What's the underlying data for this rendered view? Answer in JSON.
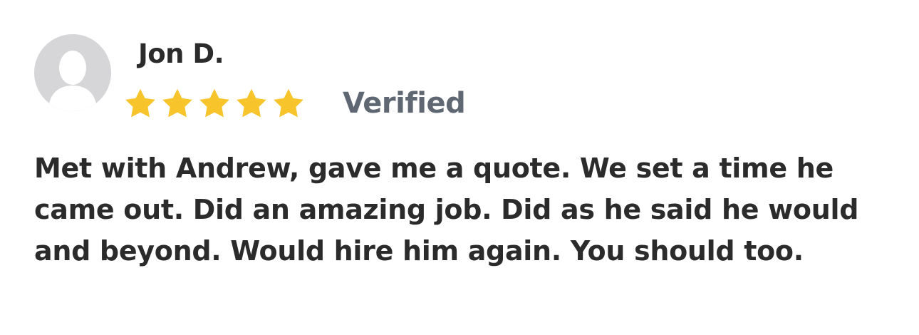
{
  "review": {
    "reviewer_name": "Jon D.",
    "rating": 5,
    "rating_max": 5,
    "verified_label": "Verified",
    "body": "Met with Andrew, gave me a quote. We set a time he came out. Did an amazing job. Did as he said he would and beyond. Would hire him again. You should too."
  },
  "colors": {
    "star": "#f7c42b",
    "avatar_bg": "#d6d6d8",
    "avatar_silhouette": "#ffffff",
    "verified": "#5f6772",
    "text": "#2b2b2b"
  },
  "icons": {
    "avatar": "user-silhouette-icon",
    "star": "star-filled-icon"
  }
}
